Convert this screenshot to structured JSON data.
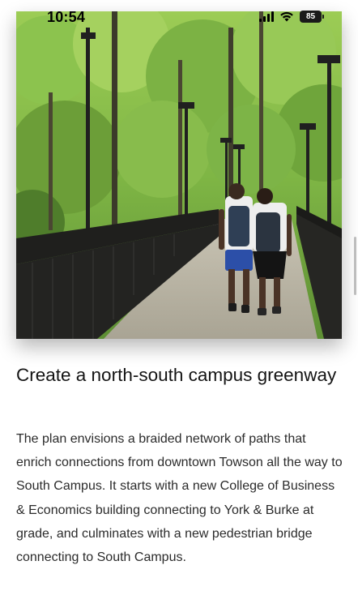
{
  "status_bar": {
    "time": "10:54",
    "battery_level": "85",
    "signal_icon": "cellular-signal-icon",
    "wifi_icon": "wifi-icon",
    "battery_icon": "battery-icon"
  },
  "article": {
    "title": "Create a north-south campus greenway",
    "body": "The plan envisions a braided network of paths that enrich connections from downtown Towson all the way to South Campus. It starts with a new College of Business & Economics building connecting to York & Burke at grade, and culminates with a new pedestrian bridge connecting to South Campus."
  },
  "colors": {
    "background": "#ffffff",
    "text": "#141414",
    "foliage": "#6aa53a"
  }
}
